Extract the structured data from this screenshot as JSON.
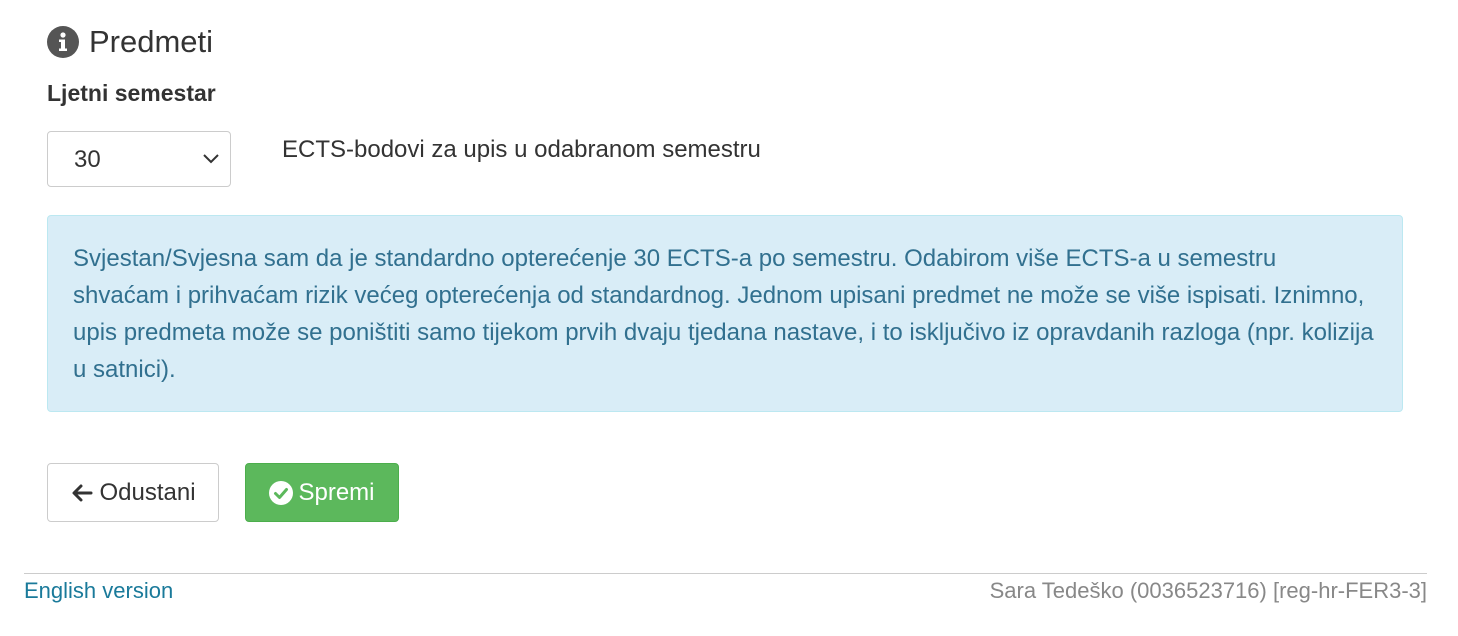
{
  "header": {
    "icon": "info-circle-icon",
    "title": "Predmeti"
  },
  "semester": {
    "label": "Ljetni semestar",
    "select_value": "30",
    "ects_description": "ECTS-bodovi za upis u odabranom semestru"
  },
  "alert": {
    "text": "Svjestan/Svjesna sam da je standardno opterećenje 30 ECTS-a po semestru. Odabirom više ECTS-a u semestru shvaćam i prihvaćam rizik većeg opterećenja od standardnog. Jednom upisani predmet ne može se više ispisati. Iznimno, upis predmeta može se poništiti samo tijekom prvih dvaju tjedana nastave, i to isključivo iz opravdanih razloga (npr. kolizija u satnici).",
    "bg_color": "#d9edf7",
    "text_color": "#31708f"
  },
  "actions": {
    "cancel_label": "Odustani",
    "cancel_icon": "arrow-left-icon",
    "save_label": "Spremi",
    "save_icon": "check-circle-icon",
    "save_color": "#5cb85c"
  },
  "footer": {
    "language_link": "English version",
    "user_info": "Sara Tedeško (0036523716) [reg-hr-FER3-3]"
  }
}
